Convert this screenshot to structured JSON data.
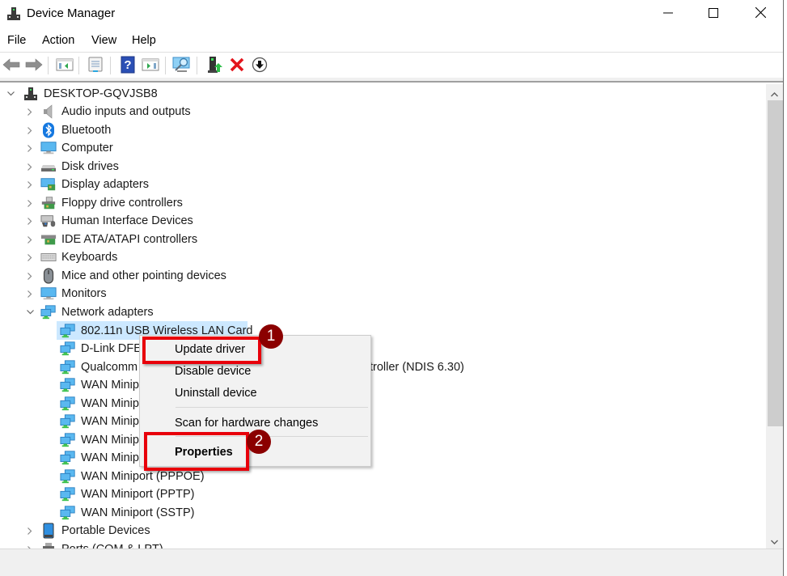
{
  "window": {
    "title": "Device Manager",
    "controls": {
      "minimize": "minimize",
      "maximize": "maximize",
      "close": "close"
    }
  },
  "menu": [
    "File",
    "Action",
    "View",
    "Help"
  ],
  "toolbar": {
    "buttons": [
      {
        "name": "back",
        "icon": "arrow-left-icon"
      },
      {
        "name": "forward",
        "icon": "arrow-right-icon"
      },
      {
        "name": "show-hide-console-tree",
        "icon": "console-tree-icon"
      },
      {
        "name": "properties",
        "icon": "properties-sheet-icon"
      },
      {
        "name": "help",
        "icon": "help-icon"
      },
      {
        "name": "show-hide-action-pane",
        "icon": "action-pane-icon"
      },
      {
        "name": "scan-hardware",
        "icon": "scan-monitor-icon"
      },
      {
        "name": "update-driver",
        "icon": "update-driver-icon"
      },
      {
        "name": "uninstall-device",
        "icon": "red-x-icon"
      },
      {
        "name": "disable-device",
        "icon": "down-arrow-circle-icon"
      }
    ]
  },
  "tree": {
    "root": {
      "label": "DESKTOP-GQVJSB8",
      "expanded": true
    },
    "categories": [
      {
        "label": "Audio inputs and outputs",
        "icon": "speaker-icon",
        "expanded": false
      },
      {
        "label": "Bluetooth",
        "icon": "bluetooth-icon",
        "expanded": false
      },
      {
        "label": "Computer",
        "icon": "computer-icon",
        "expanded": false
      },
      {
        "label": "Disk drives",
        "icon": "disk-drive-icon",
        "expanded": false
      },
      {
        "label": "Display adapters",
        "icon": "display-adapter-icon",
        "expanded": false
      },
      {
        "label": "Floppy drive controllers",
        "icon": "floppy-controller-icon",
        "expanded": false
      },
      {
        "label": "Human Interface Devices",
        "icon": "hid-icon",
        "expanded": false
      },
      {
        "label": "IDE ATA/ATAPI controllers",
        "icon": "ide-controller-icon",
        "expanded": false
      },
      {
        "label": "Keyboards",
        "icon": "keyboard-icon",
        "expanded": false
      },
      {
        "label": "Mice and other pointing devices",
        "icon": "mouse-icon",
        "expanded": false
      },
      {
        "label": "Monitors",
        "icon": "monitor-icon",
        "expanded": false
      },
      {
        "label": "Network adapters",
        "icon": "network-adapter-icon",
        "expanded": true
      },
      {
        "label": "Portable Devices",
        "icon": "portable-device-icon",
        "expanded": false
      },
      {
        "label": "Ports (COM & LPT)",
        "icon": "port-icon",
        "expanded": false
      }
    ],
    "network_adapters": [
      {
        "label": "802.11n USB Wireless LAN Card",
        "selected": true
      },
      {
        "label": "D-Link DFE"
      },
      {
        "label": "Qualcomm",
        "suffix": "troller (NDIS 6.30)"
      },
      {
        "label": "WAN Minip"
      },
      {
        "label": "WAN Minip"
      },
      {
        "label": "WAN Minip"
      },
      {
        "label": "WAN Minip"
      },
      {
        "label": "WAN Minip"
      },
      {
        "label": "WAN Miniport (PPPOE)"
      },
      {
        "label": "WAN Miniport (PPTP)"
      },
      {
        "label": "WAN Miniport (SSTP)"
      }
    ]
  },
  "context_menu": {
    "items": [
      {
        "label": "Update driver",
        "highlighted": true,
        "badge": "1"
      },
      {
        "label": "Disable device"
      },
      {
        "label": "Uninstall device"
      },
      {
        "label": "Scan for hardware changes"
      },
      {
        "label": "Properties",
        "bold": true,
        "highlighted": true,
        "badge": "2"
      }
    ]
  },
  "colors": {
    "highlight_box": "#e8000b",
    "badge": "#8b0000",
    "selection": "#cce8ff"
  }
}
